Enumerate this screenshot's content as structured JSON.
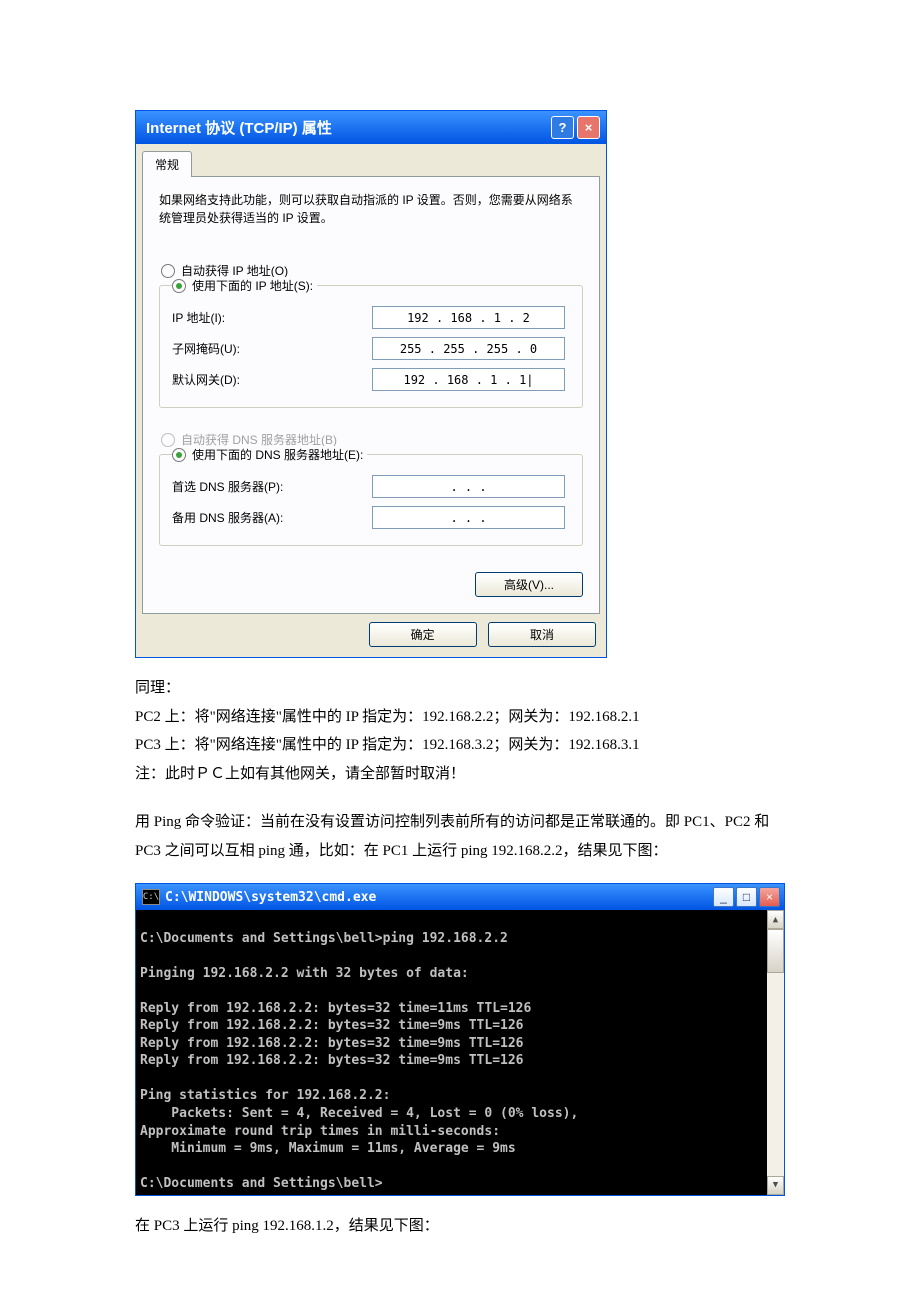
{
  "dialog": {
    "title": "Internet 协议 (TCP/IP) 属性",
    "tab": "常规",
    "tip": "如果网络支持此功能，则可以获取自动指派的 IP 设置。否则，您需要从网络系统管理员处获得适当的 IP 设置。",
    "radio_auto_ip": "自动获得 IP 地址(O)",
    "radio_manual_ip": "使用下面的 IP 地址(S):",
    "label_ip": "IP 地址(I):",
    "value_ip": "192 . 168 .  1  .  2",
    "label_mask": "子网掩码(U):",
    "value_mask": "255 . 255 . 255 .  0",
    "label_gw": "默认网关(D):",
    "value_gw": "192 . 168 .  1  .  1|",
    "radio_auto_dns": "自动获得 DNS 服务器地址(B)",
    "radio_manual_dns": "使用下面的 DNS 服务器地址(E):",
    "label_dns1": "首选 DNS 服务器(P):",
    "value_dns1": ".       .       .",
    "label_dns2": "备用 DNS 服务器(A):",
    "value_dns2": ".       .       .",
    "btn_adv": "高级(V)...",
    "btn_ok": "确定",
    "btn_cancel": "取消"
  },
  "article1": {
    "p1": "同理：",
    "p2": "PC2 上：将\"网络连接\"属性中的 IP 指定为：192.168.2.2；网关为：192.168.2.1",
    "p3": "PC3 上：将\"网络连接\"属性中的 IP 指定为：192.168.3.2；网关为：192.168.3.1",
    "p4": "注：此时ＰＣ上如有其他网关，请全部暂时取消！",
    "p5": "用 Ping 命令验证：当前在没有设置访问控制列表前所有的访问都是正常联通的。即 PC1、PC2 和 PC3 之间可以互相 ping 通，比如：在 PC1 上运行 ping 192.168.2.2，结果见下图："
  },
  "cmd": {
    "title": "C:\\WINDOWS\\system32\\cmd.exe",
    "output": "\nC:\\Documents and Settings\\bell>ping 192.168.2.2\n\nPinging 192.168.2.2 with 32 bytes of data:\n\nReply from 192.168.2.2: bytes=32 time=11ms TTL=126\nReply from 192.168.2.2: bytes=32 time=9ms TTL=126\nReply from 192.168.2.2: bytes=32 time=9ms TTL=126\nReply from 192.168.2.2: bytes=32 time=9ms TTL=126\n\nPing statistics for 192.168.2.2:\n    Packets: Sent = 4, Received = 4, Lost = 0 (0% loss),\nApproximate round trip times in milli-seconds:\n    Minimum = 9ms, Maximum = 11ms, Average = 9ms\n\nC:\\Documents and Settings\\bell>\n"
  },
  "article2": {
    "p1": "在 PC3 上运行 ping 192.168.1.2，结果见下图："
  }
}
